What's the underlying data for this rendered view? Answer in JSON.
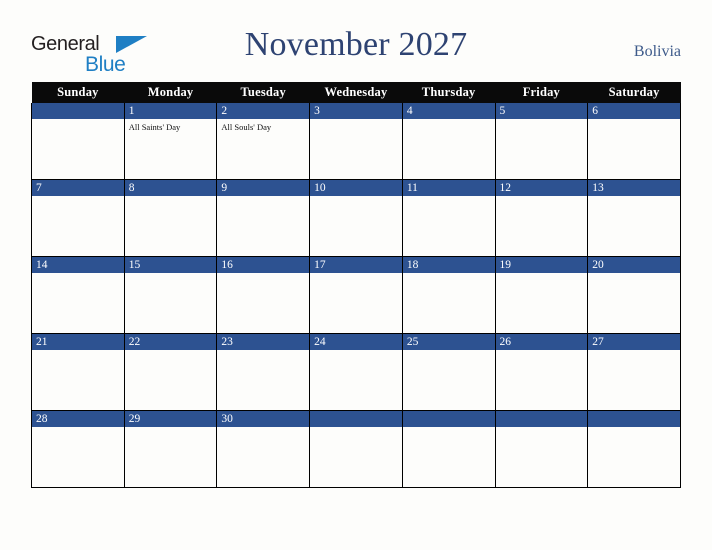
{
  "brand": {
    "name_part1": "General",
    "name_part2": "Blue",
    "triangle_color": "#1f7fc4",
    "text_color": "#231f20"
  },
  "header": {
    "title": "November 2027",
    "country": "Bolivia",
    "title_color": "#2e4372",
    "country_color": "#3d5a8a"
  },
  "calendar": {
    "header_background": "#0a0a0a",
    "daynum_background": "#2d5291",
    "cell_background": "#fdfdfb",
    "grid_color": "#000000",
    "weekday_headers": [
      "Sunday",
      "Monday",
      "Tuesday",
      "Wednesday",
      "Thursday",
      "Friday",
      "Saturday"
    ],
    "weeks": [
      [
        {
          "day": "",
          "events": []
        },
        {
          "day": "1",
          "events": [
            "All Saints' Day"
          ]
        },
        {
          "day": "2",
          "events": [
            "All Souls' Day"
          ]
        },
        {
          "day": "3",
          "events": []
        },
        {
          "day": "4",
          "events": []
        },
        {
          "day": "5",
          "events": []
        },
        {
          "day": "6",
          "events": []
        }
      ],
      [
        {
          "day": "7",
          "events": []
        },
        {
          "day": "8",
          "events": []
        },
        {
          "day": "9",
          "events": []
        },
        {
          "day": "10",
          "events": []
        },
        {
          "day": "11",
          "events": []
        },
        {
          "day": "12",
          "events": []
        },
        {
          "day": "13",
          "events": []
        }
      ],
      [
        {
          "day": "14",
          "events": []
        },
        {
          "day": "15",
          "events": []
        },
        {
          "day": "16",
          "events": []
        },
        {
          "day": "17",
          "events": []
        },
        {
          "day": "18",
          "events": []
        },
        {
          "day": "19",
          "events": []
        },
        {
          "day": "20",
          "events": []
        }
      ],
      [
        {
          "day": "21",
          "events": []
        },
        {
          "day": "22",
          "events": []
        },
        {
          "day": "23",
          "events": []
        },
        {
          "day": "24",
          "events": []
        },
        {
          "day": "25",
          "events": []
        },
        {
          "day": "26",
          "events": []
        },
        {
          "day": "27",
          "events": []
        }
      ],
      [
        {
          "day": "28",
          "events": []
        },
        {
          "day": "29",
          "events": []
        },
        {
          "day": "30",
          "events": []
        },
        {
          "day": "",
          "events": []
        },
        {
          "day": "",
          "events": []
        },
        {
          "day": "",
          "events": []
        },
        {
          "day": "",
          "events": []
        }
      ]
    ]
  }
}
